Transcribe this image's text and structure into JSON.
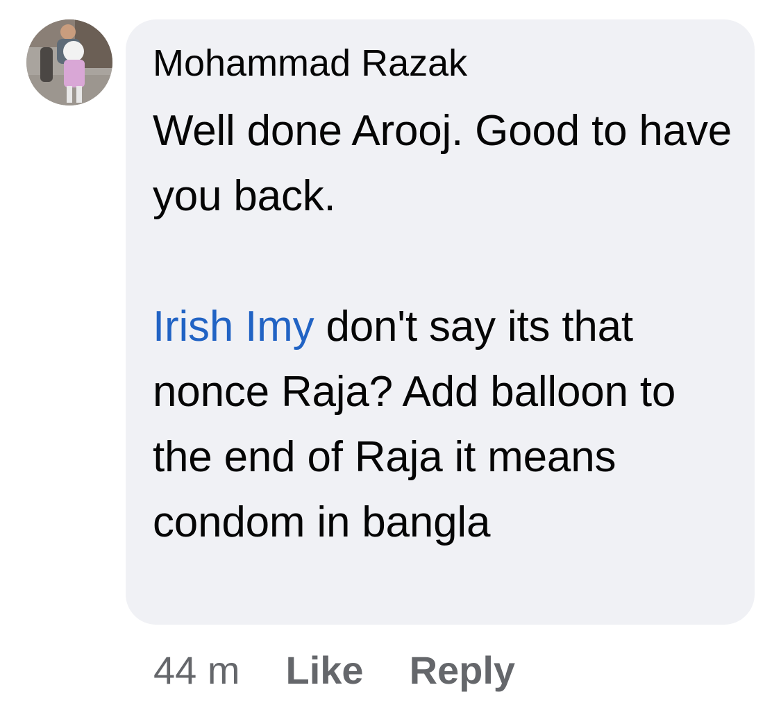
{
  "comment": {
    "author": "Mohammad Razak",
    "paragraph1": "Well done Arooj. Good to have you back.",
    "mention": "Irish Imy",
    "paragraph2_rest": " don't say its that nonce Raja? Add balloon to the end of Raja it means condom in bangla"
  },
  "actions": {
    "time": "44 m",
    "like_label": "Like",
    "reply_label": "Reply"
  },
  "colors": {
    "bubble": "#f0f1f5",
    "text": "#050505",
    "mention": "#2163c4",
    "meta": "#65676b"
  }
}
